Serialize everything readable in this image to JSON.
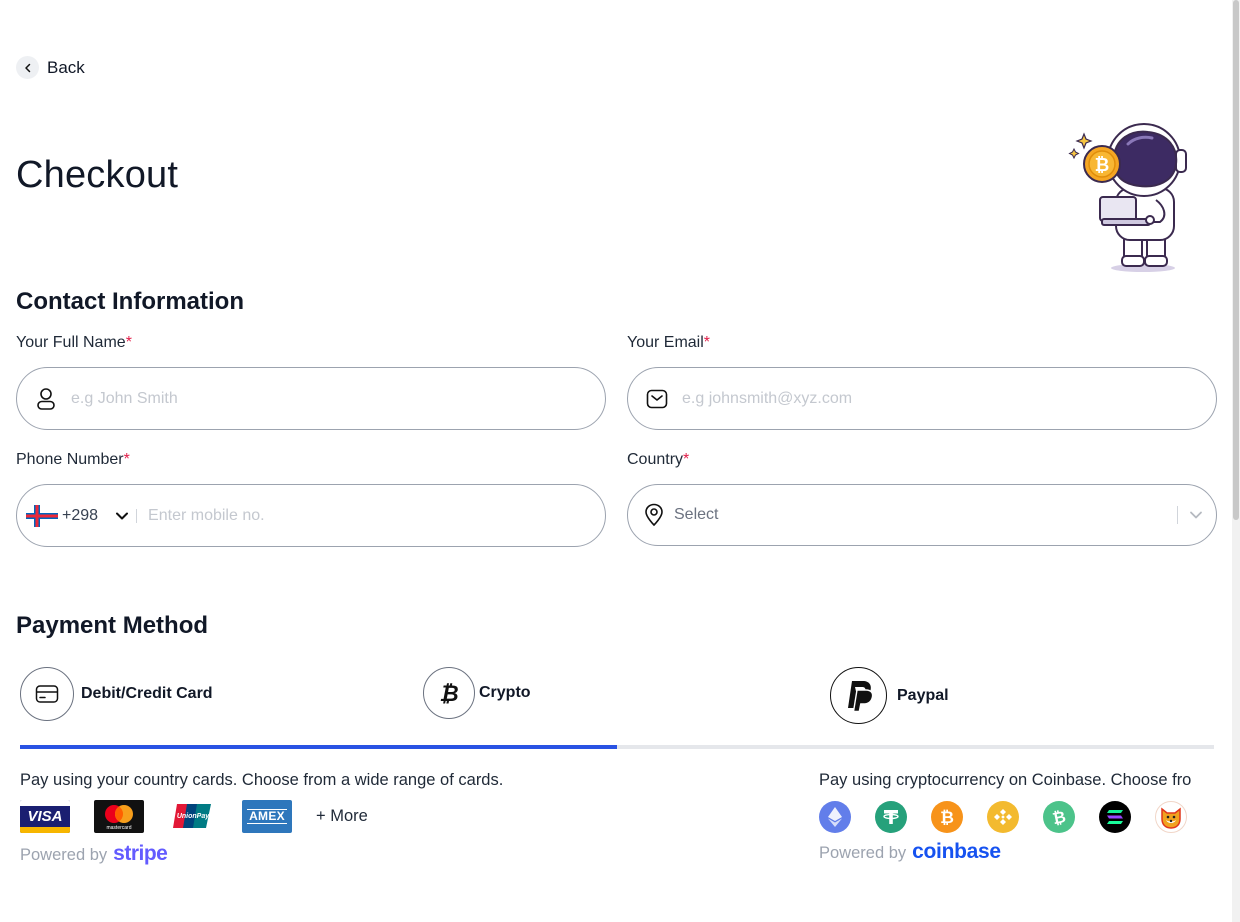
{
  "nav": {
    "back_label": "Back"
  },
  "page": {
    "title": "Checkout"
  },
  "contact": {
    "section_title": "Contact Information",
    "full_name": {
      "label": "Your Full Name",
      "required_mark": "*",
      "placeholder": "e.g John Smith"
    },
    "email": {
      "label": "Your Email",
      "required_mark": "*",
      "placeholder": "e.g johnsmith@xyz.com"
    },
    "phone": {
      "label": "Phone Number",
      "required_mark": "*",
      "country_code": "+298",
      "placeholder": "Enter mobile no."
    },
    "country": {
      "label": "Country",
      "required_mark": "*",
      "value": "Select"
    }
  },
  "payment": {
    "section_title": "Payment Method",
    "options": [
      {
        "label": "Debit/Credit Card",
        "icon": "credit-card-icon",
        "selected": true
      },
      {
        "label": "Crypto",
        "icon": "bitcoin-icon",
        "selected": false
      },
      {
        "label": "Paypal",
        "icon": "paypal-icon",
        "selected": false
      }
    ],
    "progress": 0.5,
    "card": {
      "description": "Pay using your country cards. Choose from a wide range of cards.",
      "logos": [
        "VISA",
        "mastercard",
        "UnionPay",
        "AMEX"
      ],
      "more_label": "+ More",
      "powered_by": "Powered by",
      "provider": "stripe"
    },
    "crypto": {
      "description": "Pay using cryptocurrency on Coinbase. Choose fro",
      "coins": [
        "ethereum-icon",
        "tether-icon",
        "bitcoin-icon",
        "binance-icon",
        "bitcoin-cash-icon",
        "solana-icon",
        "shiba-icon"
      ],
      "powered_by": "Powered by",
      "provider": "coinbase"
    }
  },
  "colors": {
    "accent": "#2952e3",
    "required": "#e11d48",
    "stripe": "#635bff",
    "coinbase": "#1652f0"
  }
}
